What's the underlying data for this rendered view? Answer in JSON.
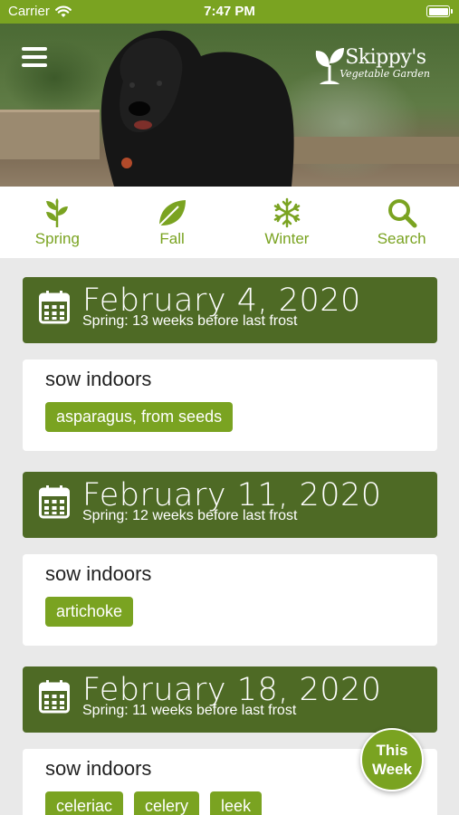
{
  "status_bar": {
    "carrier": "Carrier",
    "time": "7:47 PM",
    "wifi_icon": "wifi-icon",
    "battery_icon": "battery-full-icon"
  },
  "header": {
    "menu_icon": "hamburger-menu-icon",
    "logo_title": "Skippy's",
    "logo_subtitle": "Vegetable Garden",
    "logo_icon": "sprout-icon"
  },
  "seasons": [
    {
      "label": "Spring",
      "icon": "leaf-sprig-icon"
    },
    {
      "label": "Fall",
      "icon": "leaf-icon"
    },
    {
      "label": "Winter",
      "icon": "snowflake-icon"
    },
    {
      "label": "Search",
      "icon": "search-icon"
    }
  ],
  "weeks": [
    {
      "date": "February 4, 2020",
      "subtitle": "Spring: 13 weeks before last frost",
      "action": "sow indoors",
      "crops": [
        "asparagus, from seeds"
      ]
    },
    {
      "date": "February 11, 2020",
      "subtitle": "Spring: 12 weeks before last frost",
      "action": "sow indoors",
      "crops": [
        "artichoke"
      ]
    },
    {
      "date": "February 18, 2020",
      "subtitle": "Spring: 11 weeks before last frost",
      "action": "sow indoors",
      "crops": [
        "celeriac",
        "celery",
        "leek"
      ]
    }
  ],
  "this_week_button": {
    "line1": "This",
    "line2": "Week"
  },
  "colors": {
    "accent": "#7aa321",
    "header_dark": "#4e6a25",
    "background": "#e9e9e9"
  }
}
